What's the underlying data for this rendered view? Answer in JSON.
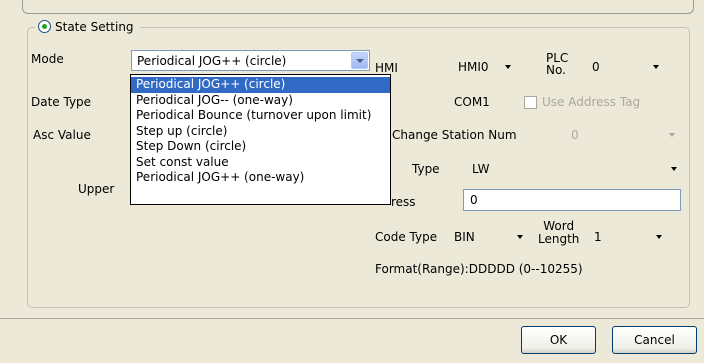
{
  "group": {
    "title": "State Setting",
    "selected": true
  },
  "mode": {
    "label": "Mode",
    "value": "Periodical JOG++ (circle)",
    "options": [
      "Periodical JOG++ (circle)",
      "Periodical JOG-- (one-way)",
      "Periodical Bounce (turnover upon limit)",
      "Step up (circle)",
      "Step Down (circle)",
      "Set const value",
      "Periodical JOG++ (one-way)"
    ],
    "selected_index": 0
  },
  "left_labels": {
    "date_type": "Date Type",
    "asc_value": "Asc Value",
    "upper": "Upper"
  },
  "hmi": {
    "label": "HMI",
    "value": "HMI0"
  },
  "plc_no": {
    "label_line1": "PLC",
    "label_line2": "No.",
    "value": "0"
  },
  "port": {
    "value": "COM1"
  },
  "use_address_tag": {
    "label": "Use Address Tag",
    "checked": false,
    "enabled": false
  },
  "change_station": {
    "label": "Change Station Num",
    "value": "0",
    "enabled": false
  },
  "addr_type": {
    "label": "Type",
    "value": "LW"
  },
  "address": {
    "label": "ress",
    "value": "0"
  },
  "code_type": {
    "label": "Code Type",
    "value": "BIN"
  },
  "word_length": {
    "label_line1": "Word",
    "label_line2": "Length",
    "value": "1"
  },
  "format": {
    "text": "Format(Range):DDDDD (0--10255)"
  },
  "buttons": {
    "ok": "OK",
    "cancel": "Cancel"
  }
}
